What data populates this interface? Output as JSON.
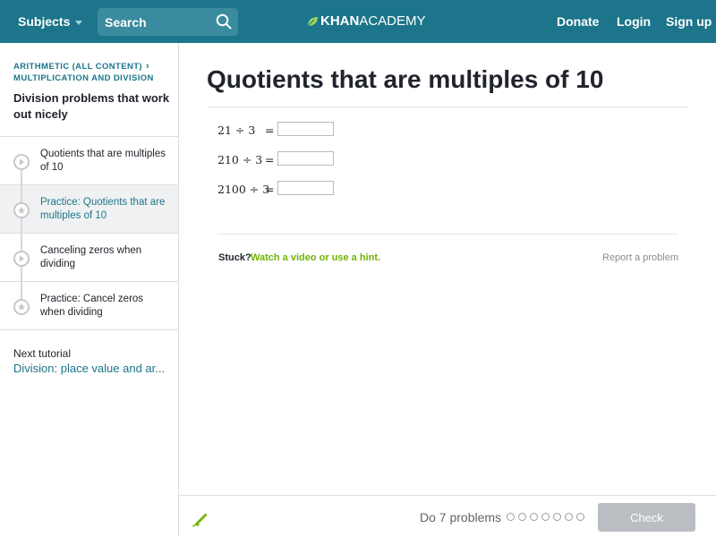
{
  "header": {
    "subjects_label": "Subjects",
    "search_placeholder": "Search",
    "logo_bold": "KHAN",
    "logo_light": "ACADEMY",
    "donate_label": "Donate",
    "login_label": "Login",
    "signup_label": "Sign up",
    "bg_color": "#1c758a"
  },
  "sidebar": {
    "crumb_line1": "ARITHMETIC (ALL CONTENT)",
    "crumb_line2": "MULTIPLICATION AND DIVISION",
    "tutorial_title": "Division problems that work out nicely",
    "items": [
      {
        "label": "Quotients that are multiples of 10",
        "icon": "play-icon",
        "active": false
      },
      {
        "label": "Practice: Quotients that are multiples of 10",
        "icon": "star-icon",
        "active": true
      },
      {
        "label": "Canceling zeros when dividing",
        "icon": "play-icon",
        "active": false
      },
      {
        "label": "Practice: Cancel zeros when dividing",
        "icon": "star-icon",
        "active": false
      }
    ],
    "next_label": "Next tutorial",
    "next_link": "Division: place value and ar..."
  },
  "main": {
    "title": "Quotients that are multiples of 10",
    "problems": [
      {
        "expr": "21 ÷ 3",
        "eq": "=",
        "value": ""
      },
      {
        "expr": "210 ÷ 3",
        "eq": "=",
        "value": ""
      },
      {
        "expr": "2100 ÷ 3",
        "eq": "=",
        "value": ""
      }
    ],
    "stuck_label": "Stuck?",
    "hint_link": "Watch a video or use a hint.",
    "report_link": "Report a problem"
  },
  "footer": {
    "do_problems": "Do 7 problems",
    "progress_total": 7,
    "progress_done": 0,
    "check_label": "Check"
  }
}
